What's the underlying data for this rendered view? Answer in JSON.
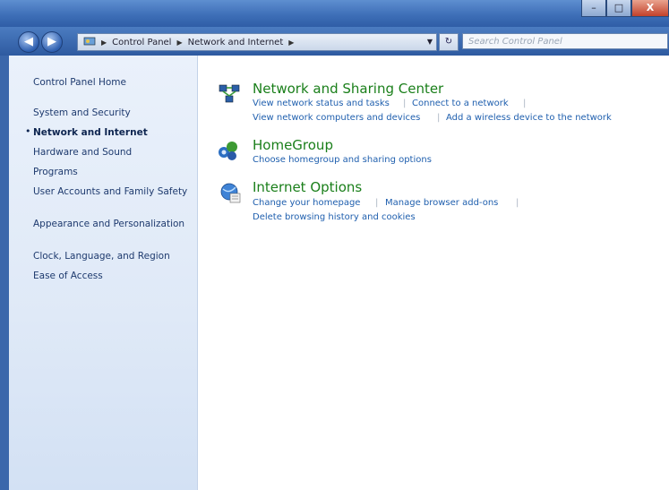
{
  "window": {
    "controls": {
      "minimize": "–",
      "maximize": "□",
      "close": "X"
    }
  },
  "address_bar": {
    "icon": "control-panel-icon",
    "segments": [
      "Control Panel",
      "Network and Internet"
    ],
    "refresh_glyph": "↻"
  },
  "search": {
    "placeholder": "Search Control Panel"
  },
  "sidebar": {
    "items": [
      {
        "label": "Control Panel Home"
      },
      {
        "label": "System and Security"
      },
      {
        "label": "Network and Internet",
        "active": true
      },
      {
        "label": "Hardware and Sound"
      },
      {
        "label": "Programs"
      },
      {
        "label": "User Accounts and Family Safety"
      },
      {
        "label": "Appearance and Personalization"
      },
      {
        "label": "Clock, Language, and Region"
      },
      {
        "label": "Ease of Access"
      }
    ]
  },
  "categories": [
    {
      "title": "Network and Sharing Center",
      "icon": "network-sharing-icon",
      "tasks": [
        "View network status and tasks",
        "Connect to a network",
        "View network computers and devices",
        "Add a wireless device to the network"
      ]
    },
    {
      "title": "HomeGroup",
      "icon": "homegroup-icon",
      "tasks": [
        "Choose homegroup and sharing options"
      ]
    },
    {
      "title": "Internet Options",
      "icon": "internet-options-icon",
      "tasks": [
        "Change your homepage",
        "Manage browser add-ons",
        "Delete browsing history and cookies"
      ]
    }
  ],
  "colors": {
    "category_title": "#1a7f1a",
    "task_link": "#1f5fae",
    "sidebar_bg": "#dfe9f7",
    "chrome_blue": "#2e5aa0"
  }
}
